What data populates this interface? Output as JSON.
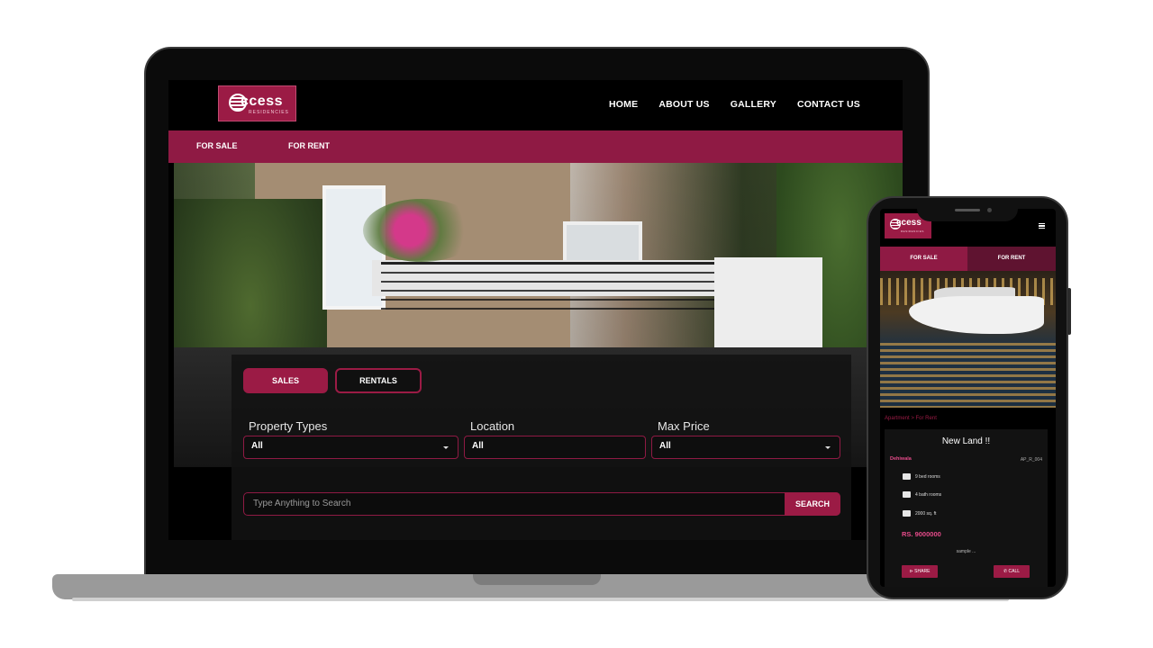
{
  "desktop": {
    "logo": {
      "word": "ccess",
      "sub": "RESIDENCIES"
    },
    "nav": [
      "HOME",
      "ABOUT US",
      "GALLERY",
      "CONTACT US"
    ],
    "categories": [
      "FOR SALE",
      "FOR RENT"
    ],
    "search": {
      "tabs": {
        "active": "SALES",
        "inactive": "RENTALS"
      },
      "filters": [
        {
          "label": "Property Types",
          "value": "All"
        },
        {
          "label": "Location",
          "value": "All"
        },
        {
          "label": "Max Price",
          "value": "All"
        }
      ],
      "placeholder": "Type Anything to Search",
      "button": "SEARCH"
    }
  },
  "mobile": {
    "logo": {
      "word": "ccess",
      "sub": "RESIDENCIES"
    },
    "tabs": [
      "FOR SALE",
      "FOR RENT"
    ],
    "breadcrumb": "Apartment  >  For Rent",
    "card": {
      "title": "New Land !!",
      "location": "Dehiwala",
      "ref": "AP_R_004",
      "features": [
        "9 bed rooms",
        "4 bath rooms",
        "2000 sq. ft"
      ],
      "price": "RS. 9000000",
      "description": "sample ...",
      "share": "SHARE",
      "call": "CALL"
    }
  },
  "colors": {
    "brand": "#9b1b45",
    "accent": "#e64b8a"
  }
}
